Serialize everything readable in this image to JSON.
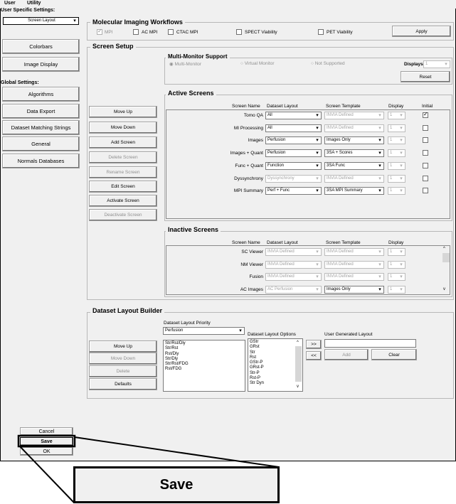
{
  "menu": [
    "User",
    "Utility"
  ],
  "left": {
    "user_header": "User Specific Settings:",
    "user_items": [
      "Screen Layout",
      "Colorbars",
      "Image Display"
    ],
    "global_header": "Global Settings:",
    "global_items": [
      "Algorithms",
      "Data Export",
      "Dataset Matching Strings",
      "General",
      "Normals Databases"
    ],
    "cancel": "Cancel",
    "save": "Save",
    "ok": "OK"
  },
  "workflows": {
    "title": "Molecular Imaging Workflows",
    "items": [
      {
        "label": "MPI",
        "checked": true
      },
      {
        "label": "AC MPI",
        "checked": false
      },
      {
        "label": "CTAC MPI",
        "checked": false
      },
      {
        "label": "SPECT Viability",
        "checked": false
      },
      {
        "label": "PET Viability",
        "checked": false
      }
    ],
    "apply": "Apply"
  },
  "setup": {
    "title": "Screen Setup",
    "multimon": {
      "title": "Multi-Monitor Support",
      "radios": [
        "Multi-Monitor",
        "Virtual Monitor",
        "Not Supported"
      ],
      "displays_label": "Displays",
      "displays_value": "1",
      "reset": "Reset"
    },
    "buttons": [
      "Move Up",
      "Move Down",
      "Add Screen",
      "Delete Screen",
      "Rename Screen",
      "Edit Screen",
      "Activate Screen",
      "Deactivate Screen"
    ],
    "active": {
      "title": "Active Screens",
      "headers": [
        "Screen Name",
        "Dataset Layout",
        "Screen Template",
        "Display",
        "Initial"
      ],
      "rows": [
        {
          "name": "Tomo QA",
          "layout": "All",
          "template": "INVIA Defined",
          "display": "1",
          "initial": true,
          "layout_dis": false,
          "template_dis": true
        },
        {
          "name": "MI Processing",
          "layout": "All",
          "template": "INVIA Defined",
          "display": "1",
          "initial": false,
          "layout_dis": false,
          "template_dis": true
        },
        {
          "name": "Images",
          "layout": "Perfusion",
          "template": "Images Only",
          "display": "1",
          "initial": false,
          "layout_dis": false,
          "template_dis": false
        },
        {
          "name": "Images + Quant",
          "layout": "Perfusion",
          "template": "3SA + Scores",
          "display": "1",
          "initial": false,
          "layout_dis": false,
          "template_dis": false
        },
        {
          "name": "Func + Quant",
          "layout": "Function",
          "template": "3SA Func",
          "display": "1",
          "initial": false,
          "layout_dis": false,
          "template_dis": false
        },
        {
          "name": "Dyssynchrony",
          "layout": "Dyssynchrony",
          "template": "INVIA Defined",
          "display": "1",
          "initial": false,
          "layout_dis": true,
          "template_dis": true
        },
        {
          "name": "MPI Summary",
          "layout": "Perf + Func",
          "template": "3SA MPI Summary",
          "display": "1",
          "initial": false,
          "layout_dis": false,
          "template_dis": false
        }
      ]
    },
    "inactive": {
      "title": "Inactive Screens",
      "headers": [
        "Screen Name",
        "Dataset Layout",
        "Screen Template",
        "Display"
      ],
      "rows": [
        {
          "name": "SC Viewer",
          "layout": "INVIA Defined",
          "template": "INVIA Defined",
          "display": "1",
          "layout_dis": true,
          "template_dis": true
        },
        {
          "name": "NM Viewer",
          "layout": "INVIA Defined",
          "template": "INVIA Defined",
          "display": "1",
          "layout_dis": true,
          "template_dis": true
        },
        {
          "name": "Fusion",
          "layout": "INVIA Defined",
          "template": "INVIA Defined",
          "display": "1",
          "layout_dis": true,
          "template_dis": true
        },
        {
          "name": "AC Images",
          "layout": "AC Perfusion",
          "template": "Images Only",
          "display": "1",
          "layout_dis": true,
          "template_dis": false
        }
      ]
    }
  },
  "builder": {
    "title": "Dataset Layout Builder",
    "priority_label": "Dataset Layout Priority",
    "priority_value": "Perfusion",
    "buttons": [
      "Move Up",
      "Move Down",
      "Delete",
      "Defaults"
    ],
    "priority_list": [
      "Str/Rst/Dly",
      "Str/Rst",
      "Rst/Dly",
      "Str/Dly",
      "Str/Rst/FDG",
      "Rst/FDG"
    ],
    "options_label": "Dataset Layout Options",
    "options_list": [
      "GStr",
      "GRst",
      "Str",
      "Rst",
      "GStr-P",
      "GRst-P",
      "Str-P",
      "Rst-P",
      "Str Dyn"
    ],
    "add_arrow": ">>",
    "remove_arrow": "<<",
    "user_label": "User Generated Layout",
    "user_value": "",
    "add": "Add",
    "clear": "Clear"
  },
  "zoom_label": "Save"
}
